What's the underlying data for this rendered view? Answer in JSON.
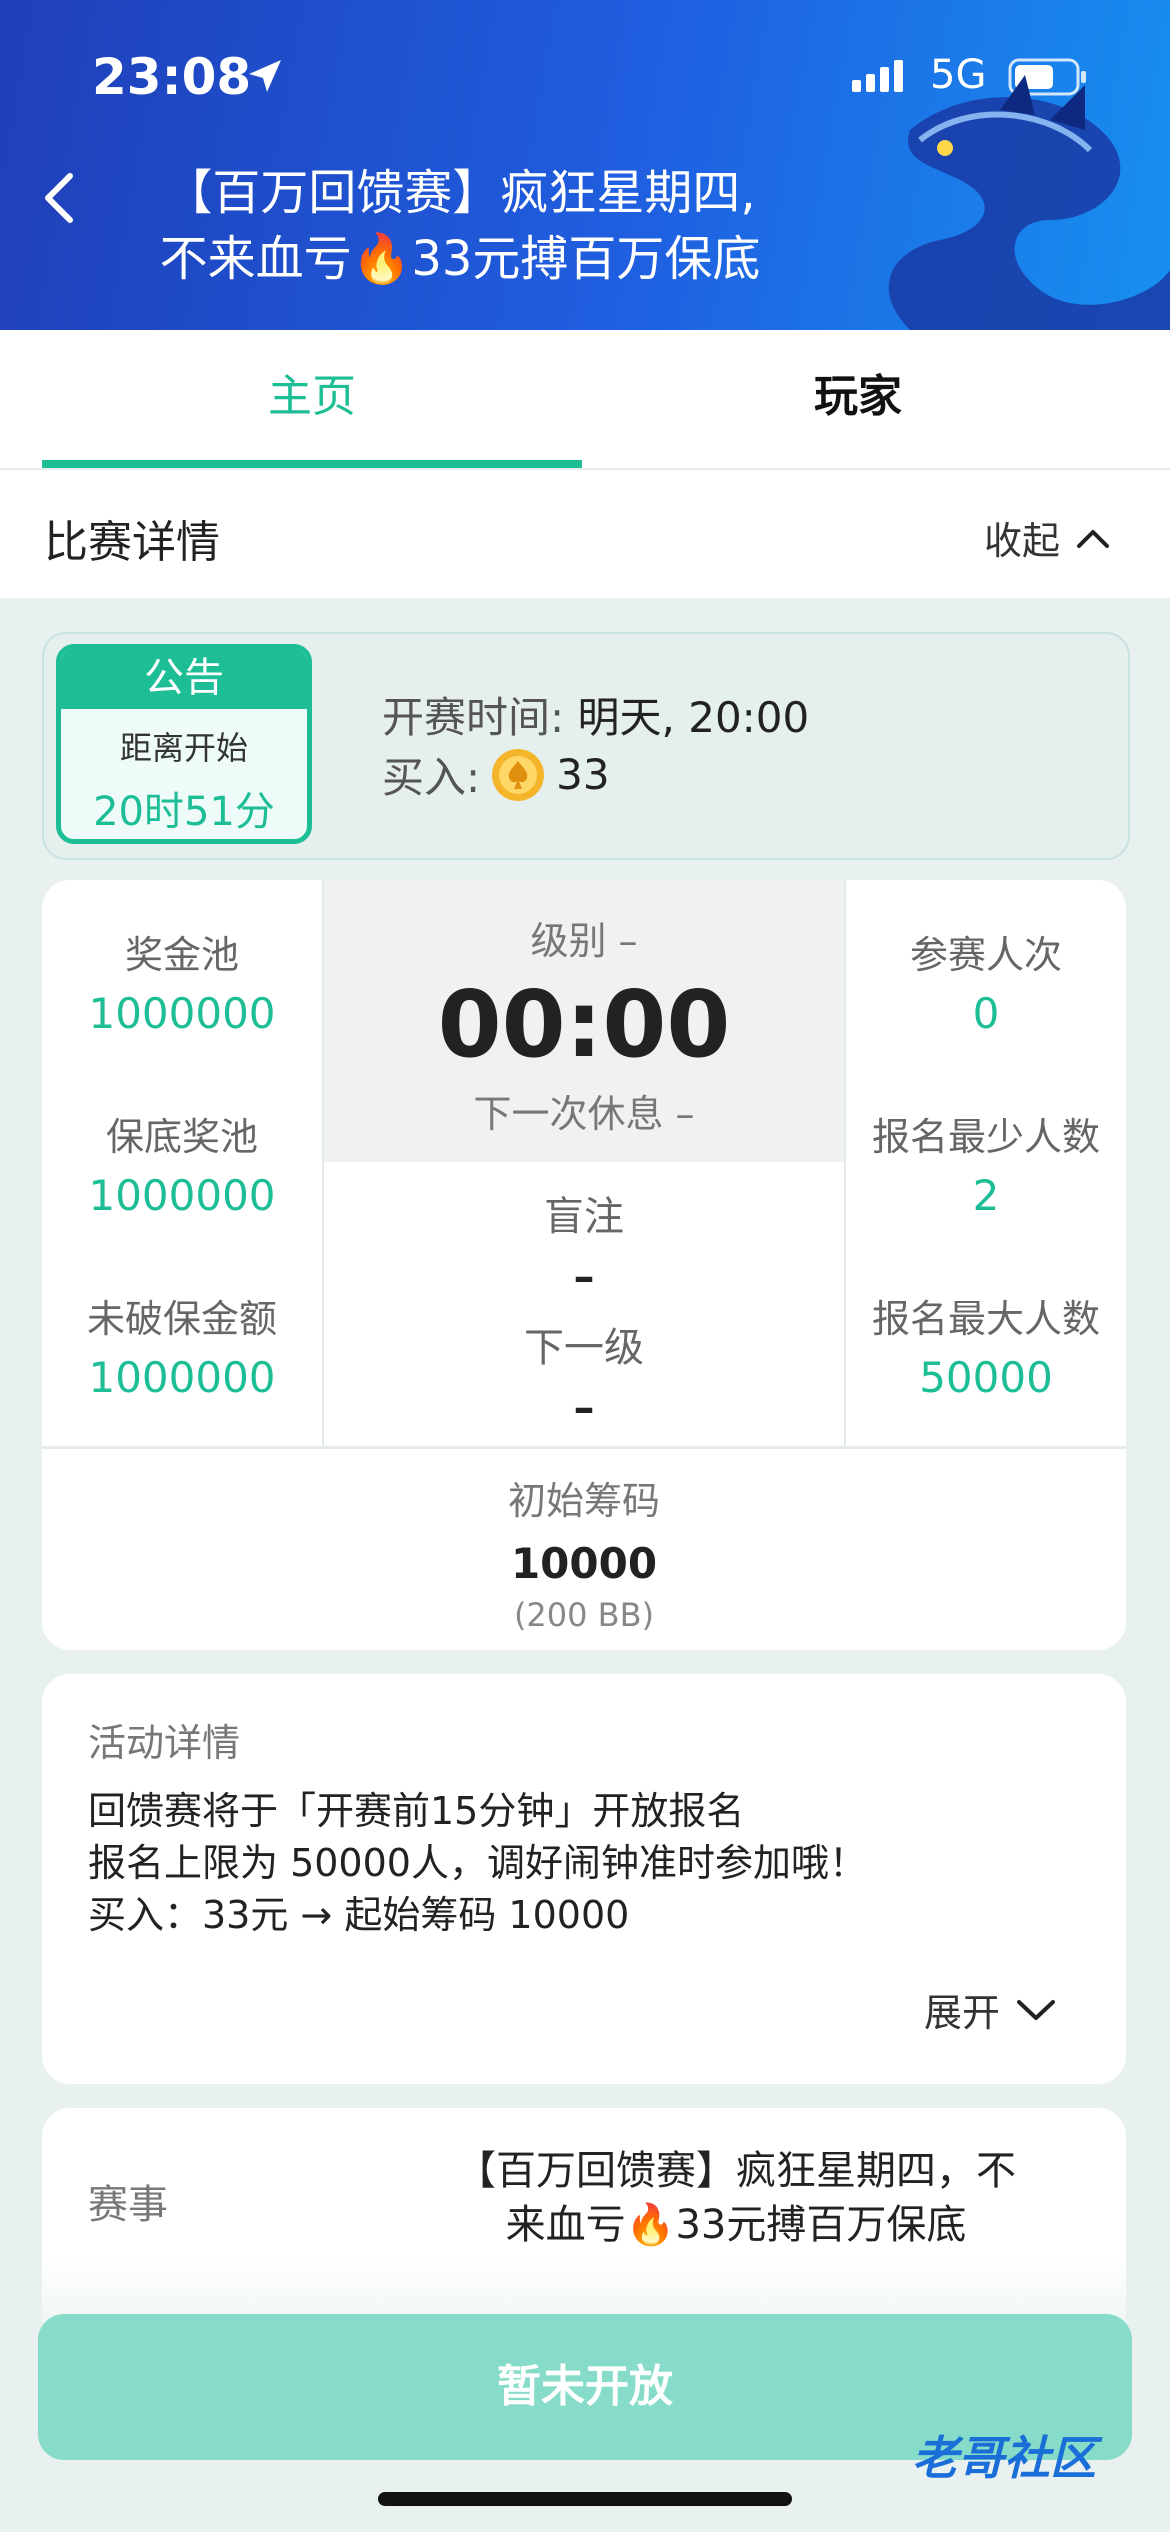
{
  "status_bar": {
    "time": "23:08",
    "network": "5G"
  },
  "header": {
    "title_line1": "【百万回馈赛】疯狂星期四,",
    "title_line2": "不来血亏🔥33元搏百万保底"
  },
  "tabs": [
    {
      "label": "主页"
    },
    {
      "label": "玩家"
    }
  ],
  "section": {
    "title": "比赛详情",
    "collapse_label": "收起"
  },
  "notice": {
    "badge_title": "公告",
    "countdown_label": "距离开始",
    "countdown_value": "20时51分",
    "start_label": "开赛时间:",
    "start_value": "明天, 20:00",
    "buyin_label": "买入:",
    "buyin_value": "33"
  },
  "stats": {
    "left": [
      {
        "label": "奖金池",
        "value": "1000000"
      },
      {
        "label": "保底奖池",
        "value": "1000000"
      },
      {
        "label": "未破保金额",
        "value": "1000000"
      }
    ],
    "right": [
      {
        "label": "参赛人次",
        "value": "0"
      },
      {
        "label": "报名最少人数",
        "value": "2"
      },
      {
        "label": "报名最大人数",
        "value": "50000"
      }
    ],
    "level_label": "级别 –",
    "timer": "00:00",
    "next_break": "下一次休息 –",
    "blind_label": "盲注",
    "blind_value": "–",
    "next_level_label": "下一级",
    "next_level_value": "–",
    "chips_label": "初始筹码",
    "chips_value": "10000",
    "chips_bb": "(200 BB)"
  },
  "activity": {
    "title": "活动详情",
    "lines": [
      "回馈赛将于「开赛前15分钟」开放报名",
      "报名上限为 50000人，调好闹钟准时参加哦！",
      "买入：33元 → 起始筹码 10000"
    ],
    "expand_label": "展开"
  },
  "event": {
    "label": "赛事",
    "value_line1": "【百万回馈赛】疯狂星期四，不",
    "value_line2": "来血亏🔥33元搏百万保底"
  },
  "cta": {
    "label": "暂未开放"
  },
  "watermark": "老哥社区",
  "colors": {
    "accent": "#1dbd96",
    "header_start": "#1f3fb8",
    "header_end": "#1790f0",
    "cta": "#86dcc8"
  }
}
